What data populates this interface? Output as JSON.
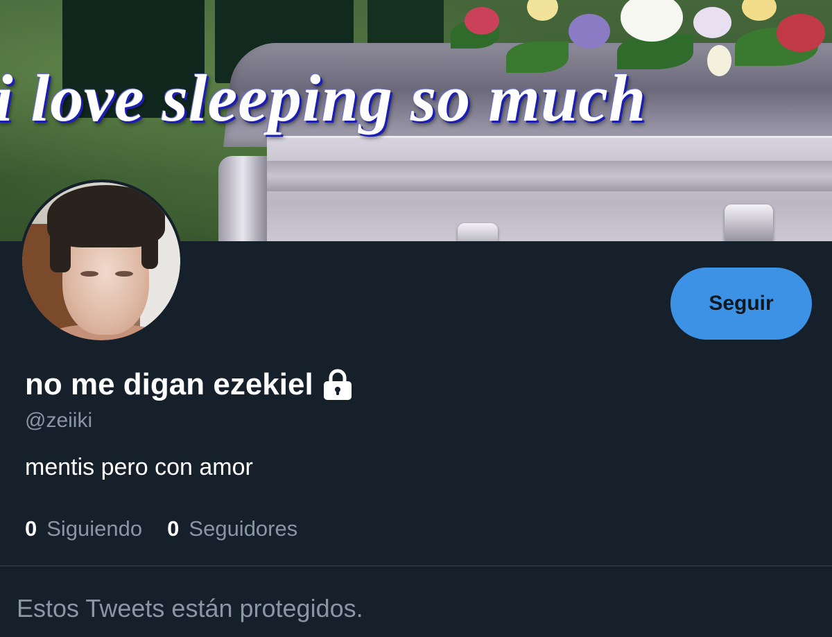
{
  "banner": {
    "caption": "i love sleeping so much"
  },
  "profile": {
    "display_name": "no me digan ezekiel",
    "handle": "@zeiiki",
    "bio": "mentis pero con amor",
    "protected_icon": "lock-icon"
  },
  "actions": {
    "follow_label": "Seguir"
  },
  "stats": {
    "following_count": "0",
    "following_label": "Siguiendo",
    "followers_count": "0",
    "followers_label": "Seguidores"
  },
  "tweets": {
    "protected_message": "Estos Tweets están protegidos."
  },
  "colors": {
    "background": "#15202b",
    "accent": "#3d92e6",
    "secondary_text": "#8a96a3",
    "divider": "#38444d"
  }
}
